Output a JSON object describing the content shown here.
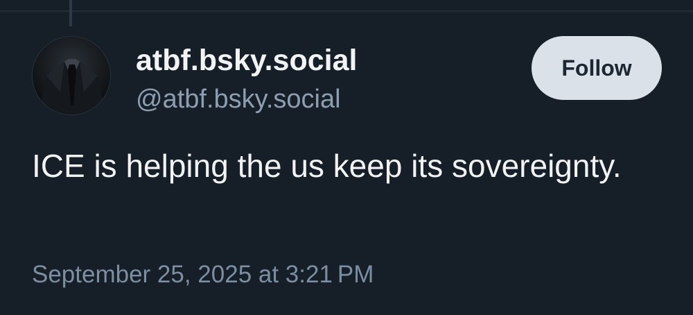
{
  "post": {
    "author": {
      "display_name": "atbf.bsky.social",
      "handle": "@atbf.bsky.social"
    },
    "follow_label": "Follow",
    "text": "ICE is helping the us keep its sovereignty.",
    "timestamp": "September 25, 2025 at 3:21 PM"
  },
  "colors": {
    "background": "#161e27",
    "primary_text": "#f1f3f5",
    "secondary_text": "#8d9eb0",
    "follow_button_bg": "#dbe1e9",
    "follow_button_text": "#1d2633"
  },
  "icons": {
    "avatar": "avatar-dark-suit-tie"
  }
}
